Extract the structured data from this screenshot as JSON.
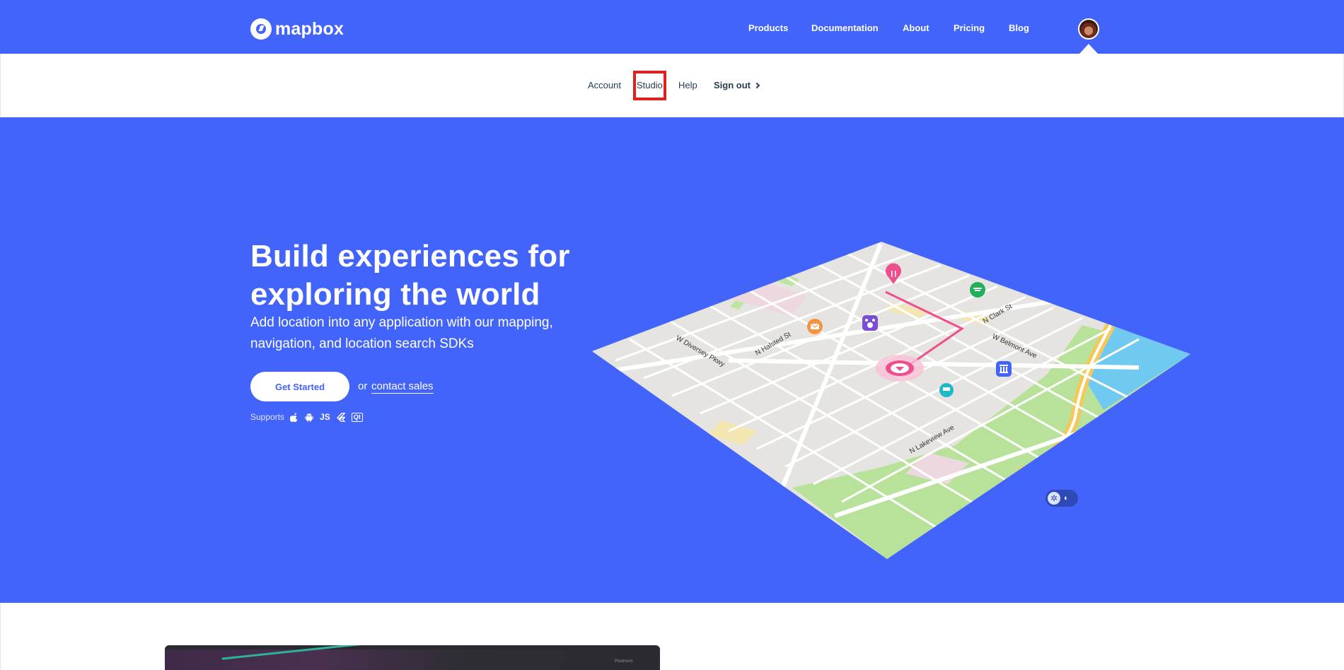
{
  "brand": {
    "logo_text": "mapbox",
    "color": "#4264fb"
  },
  "top_nav": {
    "items": [
      "Products",
      "Documentation",
      "About",
      "Pricing",
      "Blog"
    ]
  },
  "sub_nav": {
    "account": "Account",
    "studio": "Studio",
    "help": "Help",
    "sign_out": "Sign out"
  },
  "hero": {
    "title": "Build experiences for exploring the world",
    "subtitle": "Add location into any application with our mapping, navigation, and location search SDKs",
    "cta_label": "Get Started",
    "or_text": "or",
    "contact_label": "contact sales",
    "supports_label": "Supports",
    "supports_icons": [
      "apple-icon",
      "android-icon",
      "js-icon",
      "flutter-icon",
      "qt-icon"
    ],
    "js_label": "JS",
    "qt_label": "Qt"
  },
  "map": {
    "street_labels": [
      "W Diversey Pkwy",
      "N Halsted St",
      "N Clark St",
      "W Belmont Ave",
      "N Lakeview Ave"
    ],
    "poi_icons": [
      "restaurant-pin-icon",
      "picnic-icon",
      "mail-icon",
      "pet-icon",
      "museum-icon",
      "shopping-cart-icon",
      "current-location-icon"
    ]
  },
  "preview": {
    "label": "Piedmont"
  },
  "highlight_color": "#e02020"
}
